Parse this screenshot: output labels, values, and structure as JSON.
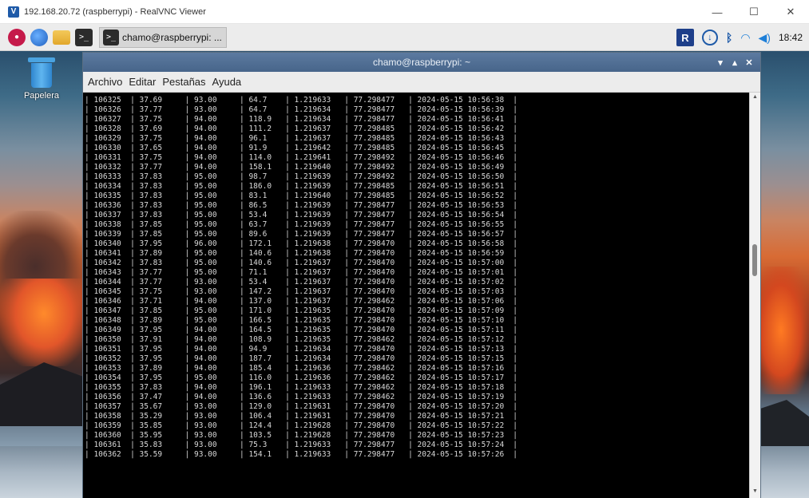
{
  "outer_window": {
    "title": "192.168.20.72 (raspberrypi) - RealVNC Viewer",
    "controls": {
      "minimize": "—",
      "maximize": "☐",
      "close": "✕"
    }
  },
  "taskbar": {
    "task_label": "chamo@raspberrypi: ...",
    "clock": "18:42",
    "tray_rv": "R"
  },
  "desktop": {
    "trash_label": "Papelera"
  },
  "terminal": {
    "title": "chamo@raspberrypi: ~",
    "controls": {
      "minimize": "▾",
      "maximize": "▴",
      "close": "✕"
    },
    "menu": [
      "Archivo",
      "Editar",
      "Pestañas",
      "Ayuda"
    ],
    "rows": [
      [
        "106325",
        "37.69",
        "93.00",
        "64.7",
        "1.219633",
        "77.298477",
        "2024-05-15 10:56:38"
      ],
      [
        "106326",
        "37.77",
        "93.00",
        "64.7",
        "1.219634",
        "77.298477",
        "2024-05-15 10:56:39"
      ],
      [
        "106327",
        "37.75",
        "94.00",
        "118.9",
        "1.219634",
        "77.298477",
        "2024-05-15 10:56:41"
      ],
      [
        "106328",
        "37.69",
        "94.00",
        "111.2",
        "1.219637",
        "77.298485",
        "2024-05-15 10:56:42"
      ],
      [
        "106329",
        "37.75",
        "94.00",
        "96.1",
        "1.219637",
        "77.298485",
        "2024-05-15 10:56:43"
      ],
      [
        "106330",
        "37.65",
        "94.00",
        "91.9",
        "1.219642",
        "77.298485",
        "2024-05-15 10:56:45"
      ],
      [
        "106331",
        "37.75",
        "94.00",
        "114.0",
        "1.219641",
        "77.298492",
        "2024-05-15 10:56:46"
      ],
      [
        "106332",
        "37.77",
        "94.00",
        "158.1",
        "1.219640",
        "77.298492",
        "2024-05-15 10:56:49"
      ],
      [
        "106333",
        "37.83",
        "95.00",
        "98.7",
        "1.219639",
        "77.298492",
        "2024-05-15 10:56:50"
      ],
      [
        "106334",
        "37.83",
        "95.00",
        "186.0",
        "1.219639",
        "77.298485",
        "2024-05-15 10:56:51"
      ],
      [
        "106335",
        "37.83",
        "95.00",
        "83.1",
        "1.219640",
        "77.298485",
        "2024-05-15 10:56:52"
      ],
      [
        "106336",
        "37.83",
        "95.00",
        "86.5",
        "1.219639",
        "77.298477",
        "2024-05-15 10:56:53"
      ],
      [
        "106337",
        "37.83",
        "95.00",
        "53.4",
        "1.219639",
        "77.298477",
        "2024-05-15 10:56:54"
      ],
      [
        "106338",
        "37.85",
        "95.00",
        "63.7",
        "1.219639",
        "77.298477",
        "2024-05-15 10:56:55"
      ],
      [
        "106339",
        "37.85",
        "95.00",
        "89.6",
        "1.219639",
        "77.298477",
        "2024-05-15 10:56:57"
      ],
      [
        "106340",
        "37.95",
        "96.00",
        "172.1",
        "1.219638",
        "77.298470",
        "2024-05-15 10:56:58"
      ],
      [
        "106341",
        "37.89",
        "95.00",
        "140.6",
        "1.219638",
        "77.298470",
        "2024-05-15 10:56:59"
      ],
      [
        "106342",
        "37.83",
        "95.00",
        "140.6",
        "1.219637",
        "77.298470",
        "2024-05-15 10:57:00"
      ],
      [
        "106343",
        "37.77",
        "95.00",
        "71.1",
        "1.219637",
        "77.298470",
        "2024-05-15 10:57:01"
      ],
      [
        "106344",
        "37.77",
        "93.00",
        "53.4",
        "1.219637",
        "77.298470",
        "2024-05-15 10:57:02"
      ],
      [
        "106345",
        "37.75",
        "93.00",
        "147.2",
        "1.219637",
        "77.298470",
        "2024-05-15 10:57:03"
      ],
      [
        "106346",
        "37.71",
        "94.00",
        "137.0",
        "1.219637",
        "77.298462",
        "2024-05-15 10:57:06"
      ],
      [
        "106347",
        "37.85",
        "95.00",
        "171.0",
        "1.219635",
        "77.298470",
        "2024-05-15 10:57:09"
      ],
      [
        "106348",
        "37.89",
        "95.00",
        "166.5",
        "1.219635",
        "77.298470",
        "2024-05-15 10:57:10"
      ],
      [
        "106349",
        "37.95",
        "94.00",
        "164.5",
        "1.219635",
        "77.298470",
        "2024-05-15 10:57:11"
      ],
      [
        "106350",
        "37.91",
        "94.00",
        "108.9",
        "1.219635",
        "77.298462",
        "2024-05-15 10:57:12"
      ],
      [
        "106351",
        "37.95",
        "94.00",
        "94.9",
        "1.219634",
        "77.298470",
        "2024-05-15 10:57:13"
      ],
      [
        "106352",
        "37.95",
        "94.00",
        "187.7",
        "1.219634",
        "77.298470",
        "2024-05-15 10:57:15"
      ],
      [
        "106353",
        "37.89",
        "94.00",
        "185.4",
        "1.219636",
        "77.298462",
        "2024-05-15 10:57:16"
      ],
      [
        "106354",
        "37.95",
        "95.00",
        "116.0",
        "1.219636",
        "77.298462",
        "2024-05-15 10:57:17"
      ],
      [
        "106355",
        "37.83",
        "94.00",
        "196.1",
        "1.219633",
        "77.298462",
        "2024-05-15 10:57:18"
      ],
      [
        "106356",
        "37.47",
        "94.00",
        "136.6",
        "1.219633",
        "77.298462",
        "2024-05-15 10:57:19"
      ],
      [
        "106357",
        "35.67",
        "93.00",
        "129.0",
        "1.219631",
        "77.298470",
        "2024-05-15 10:57:20"
      ],
      [
        "106358",
        "35.29",
        "93.00",
        "106.4",
        "1.219631",
        "77.298470",
        "2024-05-15 10:57:21"
      ],
      [
        "106359",
        "35.85",
        "93.00",
        "124.4",
        "1.219628",
        "77.298470",
        "2024-05-15 10:57:22"
      ],
      [
        "106360",
        "35.95",
        "93.00",
        "103.5",
        "1.219628",
        "77.298470",
        "2024-05-15 10:57:23"
      ],
      [
        "106361",
        "35.83",
        "93.00",
        "75.3",
        "1.219633",
        "77.298477",
        "2024-05-15 10:57:24"
      ],
      [
        "106362",
        "35.59",
        "93.00",
        "154.1",
        "1.219633",
        "77.298477",
        "2024-05-15 10:57:26"
      ]
    ]
  }
}
